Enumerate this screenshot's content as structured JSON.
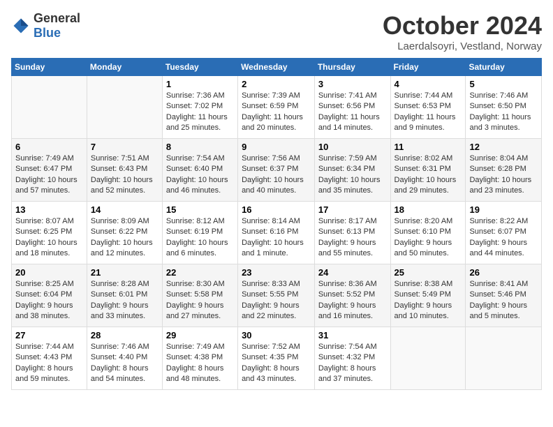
{
  "header": {
    "logo_general": "General",
    "logo_blue": "Blue",
    "title": "October 2024",
    "location": "Laerdalsoyri, Vestland, Norway"
  },
  "weekdays": [
    "Sunday",
    "Monday",
    "Tuesday",
    "Wednesday",
    "Thursday",
    "Friday",
    "Saturday"
  ],
  "weeks": [
    [
      {
        "day": "",
        "info": ""
      },
      {
        "day": "",
        "info": ""
      },
      {
        "day": "1",
        "info": "Sunrise: 7:36 AM\nSunset: 7:02 PM\nDaylight: 11 hours and 25 minutes."
      },
      {
        "day": "2",
        "info": "Sunrise: 7:39 AM\nSunset: 6:59 PM\nDaylight: 11 hours and 20 minutes."
      },
      {
        "day": "3",
        "info": "Sunrise: 7:41 AM\nSunset: 6:56 PM\nDaylight: 11 hours and 14 minutes."
      },
      {
        "day": "4",
        "info": "Sunrise: 7:44 AM\nSunset: 6:53 PM\nDaylight: 11 hours and 9 minutes."
      },
      {
        "day": "5",
        "info": "Sunrise: 7:46 AM\nSunset: 6:50 PM\nDaylight: 11 hours and 3 minutes."
      }
    ],
    [
      {
        "day": "6",
        "info": "Sunrise: 7:49 AM\nSunset: 6:47 PM\nDaylight: 10 hours and 57 minutes."
      },
      {
        "day": "7",
        "info": "Sunrise: 7:51 AM\nSunset: 6:43 PM\nDaylight: 10 hours and 52 minutes."
      },
      {
        "day": "8",
        "info": "Sunrise: 7:54 AM\nSunset: 6:40 PM\nDaylight: 10 hours and 46 minutes."
      },
      {
        "day": "9",
        "info": "Sunrise: 7:56 AM\nSunset: 6:37 PM\nDaylight: 10 hours and 40 minutes."
      },
      {
        "day": "10",
        "info": "Sunrise: 7:59 AM\nSunset: 6:34 PM\nDaylight: 10 hours and 35 minutes."
      },
      {
        "day": "11",
        "info": "Sunrise: 8:02 AM\nSunset: 6:31 PM\nDaylight: 10 hours and 29 minutes."
      },
      {
        "day": "12",
        "info": "Sunrise: 8:04 AM\nSunset: 6:28 PM\nDaylight: 10 hours and 23 minutes."
      }
    ],
    [
      {
        "day": "13",
        "info": "Sunrise: 8:07 AM\nSunset: 6:25 PM\nDaylight: 10 hours and 18 minutes."
      },
      {
        "day": "14",
        "info": "Sunrise: 8:09 AM\nSunset: 6:22 PM\nDaylight: 10 hours and 12 minutes."
      },
      {
        "day": "15",
        "info": "Sunrise: 8:12 AM\nSunset: 6:19 PM\nDaylight: 10 hours and 6 minutes."
      },
      {
        "day": "16",
        "info": "Sunrise: 8:14 AM\nSunset: 6:16 PM\nDaylight: 10 hours and 1 minute."
      },
      {
        "day": "17",
        "info": "Sunrise: 8:17 AM\nSunset: 6:13 PM\nDaylight: 9 hours and 55 minutes."
      },
      {
        "day": "18",
        "info": "Sunrise: 8:20 AM\nSunset: 6:10 PM\nDaylight: 9 hours and 50 minutes."
      },
      {
        "day": "19",
        "info": "Sunrise: 8:22 AM\nSunset: 6:07 PM\nDaylight: 9 hours and 44 minutes."
      }
    ],
    [
      {
        "day": "20",
        "info": "Sunrise: 8:25 AM\nSunset: 6:04 PM\nDaylight: 9 hours and 38 minutes."
      },
      {
        "day": "21",
        "info": "Sunrise: 8:28 AM\nSunset: 6:01 PM\nDaylight: 9 hours and 33 minutes."
      },
      {
        "day": "22",
        "info": "Sunrise: 8:30 AM\nSunset: 5:58 PM\nDaylight: 9 hours and 27 minutes."
      },
      {
        "day": "23",
        "info": "Sunrise: 8:33 AM\nSunset: 5:55 PM\nDaylight: 9 hours and 22 minutes."
      },
      {
        "day": "24",
        "info": "Sunrise: 8:36 AM\nSunset: 5:52 PM\nDaylight: 9 hours and 16 minutes."
      },
      {
        "day": "25",
        "info": "Sunrise: 8:38 AM\nSunset: 5:49 PM\nDaylight: 9 hours and 10 minutes."
      },
      {
        "day": "26",
        "info": "Sunrise: 8:41 AM\nSunset: 5:46 PM\nDaylight: 9 hours and 5 minutes."
      }
    ],
    [
      {
        "day": "27",
        "info": "Sunrise: 7:44 AM\nSunset: 4:43 PM\nDaylight: 8 hours and 59 minutes."
      },
      {
        "day": "28",
        "info": "Sunrise: 7:46 AM\nSunset: 4:40 PM\nDaylight: 8 hours and 54 minutes."
      },
      {
        "day": "29",
        "info": "Sunrise: 7:49 AM\nSunset: 4:38 PM\nDaylight: 8 hours and 48 minutes."
      },
      {
        "day": "30",
        "info": "Sunrise: 7:52 AM\nSunset: 4:35 PM\nDaylight: 8 hours and 43 minutes."
      },
      {
        "day": "31",
        "info": "Sunrise: 7:54 AM\nSunset: 4:32 PM\nDaylight: 8 hours and 37 minutes."
      },
      {
        "day": "",
        "info": ""
      },
      {
        "day": "",
        "info": ""
      }
    ]
  ]
}
